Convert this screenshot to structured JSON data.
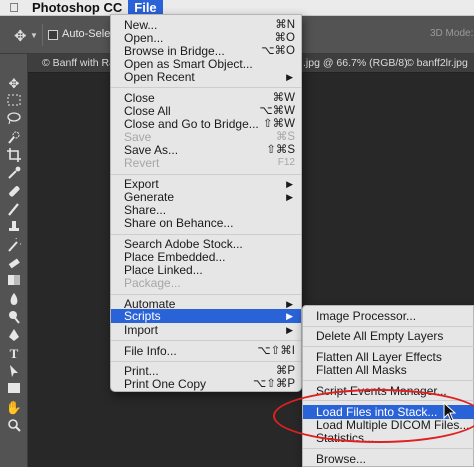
{
  "menubar": {
    "app_name": "Photoshop CC",
    "file_label": "File"
  },
  "options_bar": {
    "auto_select_label": "Auto-Select:",
    "mode_3d_label": "3D Mode:"
  },
  "tabs": [
    "© Banff with Ram",
    ".jpg @ 66.7% (RGB/8)",
    "© banff2lr.jpg"
  ],
  "file_menu": {
    "new": {
      "label": "New...",
      "shortcut": "⌘N"
    },
    "open": {
      "label": "Open...",
      "shortcut": "⌘O"
    },
    "browse_bridge": {
      "label": "Browse in Bridge...",
      "shortcut": "⌥⌘O"
    },
    "open_smart": {
      "label": "Open as Smart Object..."
    },
    "open_recent": {
      "label": "Open Recent"
    },
    "close": {
      "label": "Close",
      "shortcut": "⌘W"
    },
    "close_all": {
      "label": "Close All",
      "shortcut": "⌥⌘W"
    },
    "close_bridge": {
      "label": "Close and Go to Bridge...",
      "shortcut": "⇧⌘W"
    },
    "save": {
      "label": "Save",
      "shortcut": "⌘S"
    },
    "save_as": {
      "label": "Save As...",
      "shortcut": "⇧⌘S"
    },
    "revert": {
      "label": "Revert",
      "shortcut": "F12"
    },
    "export": {
      "label": "Export"
    },
    "generate": {
      "label": "Generate"
    },
    "share": {
      "label": "Share..."
    },
    "share_behance": {
      "label": "Share on Behance..."
    },
    "search_stock": {
      "label": "Search Adobe Stock..."
    },
    "place_embedded": {
      "label": "Place Embedded..."
    },
    "place_linked": {
      "label": "Place Linked..."
    },
    "package": {
      "label": "Package..."
    },
    "automate": {
      "label": "Automate"
    },
    "scripts": {
      "label": "Scripts"
    },
    "import": {
      "label": "Import"
    },
    "file_info": {
      "label": "File Info...",
      "shortcut": "⌥⇧⌘I"
    },
    "print": {
      "label": "Print...",
      "shortcut": "⌘P"
    },
    "print_one": {
      "label": "Print One Copy",
      "shortcut": "⌥⇧⌘P"
    }
  },
  "scripts_menu": {
    "image_processor": "Image Processor...",
    "delete_empty": "Delete All Empty Layers",
    "flatten_effects": "Flatten All Layer Effects",
    "flatten_masks": "Flatten All Masks",
    "events_manager": "Script Events Manager...",
    "load_stack": "Load Files into Stack...",
    "load_dicom": "Load Multiple DICOM Files...",
    "statistics": "Statistics...",
    "browse": "Browse..."
  },
  "colors": {
    "highlight": "#2a63d8",
    "annotation": "#e02020"
  }
}
